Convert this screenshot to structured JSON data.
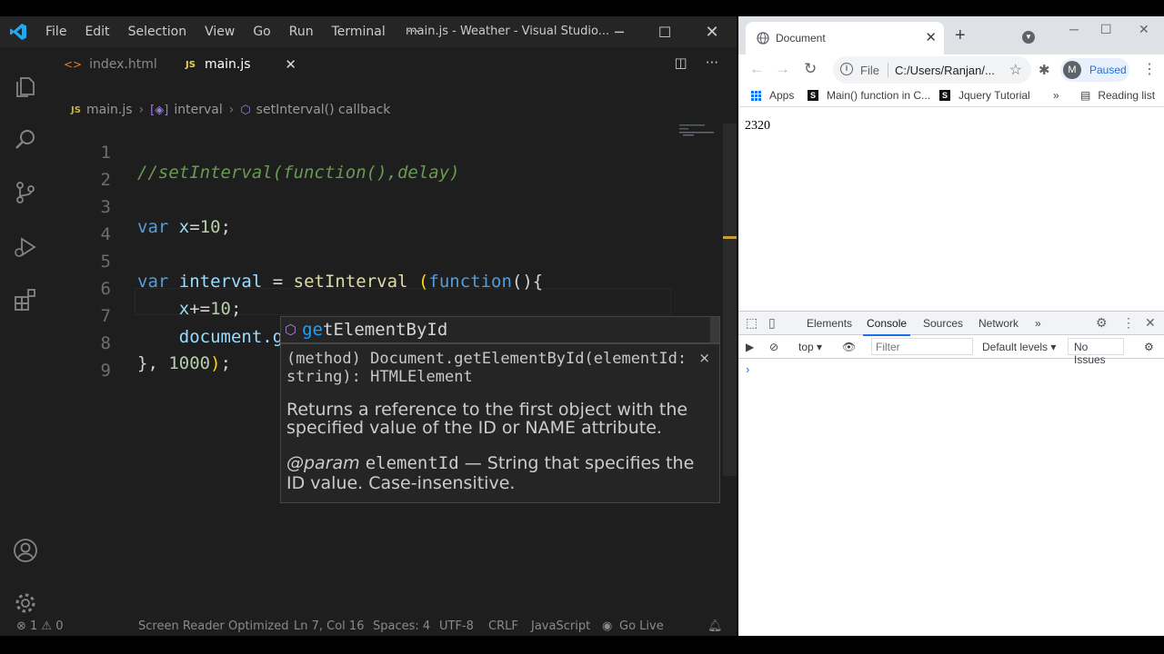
{
  "vscode": {
    "menu": [
      "File",
      "Edit",
      "Selection",
      "View",
      "Go",
      "Run",
      "Terminal",
      "···"
    ],
    "window_title": "main.js - Weather - Visual Studio...",
    "tabs": [
      {
        "icon": "<>",
        "label": "index.html"
      },
      {
        "icon": "JS",
        "label": "main.js",
        "close": "✕"
      }
    ],
    "breadcrumb": [
      "main.js",
      "interval",
      "setInterval() callback"
    ],
    "line_numbers": [
      "1",
      "2",
      "3",
      "4",
      "5",
      "6",
      "7",
      "8",
      "9"
    ],
    "code_lines": [
      "//setInterval(function(),delay)",
      "",
      "var x=10;",
      "",
      "var interval = setInterval (function(){",
      "    x+=10;",
      "    document.ge",
      "}, 1000);",
      ""
    ],
    "suggestion": {
      "match": "ge",
      "rest": "tElementById"
    },
    "detail": {
      "signature": "(method) Document.getElementById(elementId: string): HTMLElement",
      "close": "×",
      "description": "Returns a reference to the first object with the specified value of the ID or NAME attribute.",
      "param_tag": "@param",
      "param_name": "elementId",
      "param_desc": "— String that specifies the ID value. Case-insensitive."
    },
    "status": {
      "problems": "⊗ 1 ⚠ 0",
      "screen_reader": "Screen Reader Optimized",
      "position": "Ln 7, Col 16",
      "spaces": "Spaces: 4",
      "encoding": "UTF-8",
      "eol": "CRLF",
      "language": "JavaScript",
      "go_live": "Go Live"
    }
  },
  "chrome": {
    "tab_title": "Document",
    "omnibox_scheme": "File",
    "omnibox_url": "C:/Users/Ranjan/...",
    "profile_initial": "M",
    "profile_status": "Paused",
    "bookmarks": [
      "Apps",
      "Main() function in C...",
      "Jquery Tutorial",
      "»",
      "Reading list"
    ],
    "bookmark_badges": [
      "S",
      "S"
    ],
    "page_value": "2320",
    "devtools": {
      "tabs": [
        "Elements",
        "Console",
        "Sources",
        "Network",
        "»"
      ],
      "active_tab": "Console",
      "context": "top ▾",
      "filter_placeholder": "Filter",
      "levels": "Default levels ▾",
      "issues": "No Issues",
      "prompt": "›"
    }
  },
  "colors": {
    "editor_bg": "#1e1e1e",
    "keyword": "#569cd6",
    "number": "#b5cea8",
    "comment": "#6a9955",
    "function": "#dcdcaa",
    "suggest_highlight": "#18a3ff",
    "accent": "#1a73e8"
  }
}
